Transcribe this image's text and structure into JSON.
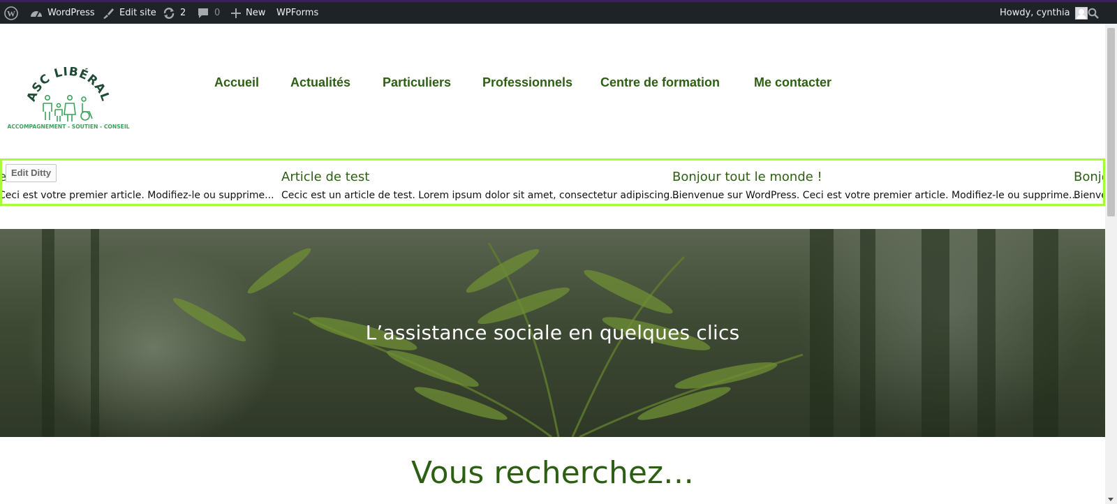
{
  "adminbar": {
    "site_name": "WordPress",
    "edit_site": "Edit site",
    "updates_count": "2",
    "comments_count": "0",
    "new_label": "New",
    "wpforms_label": "WPForms",
    "howdy": "Howdy, cynthia",
    "colors": {
      "bg": "#1d2327",
      "text": "#f0f0f1"
    }
  },
  "logo": {
    "brand_text": "ASC LIBÉRAL",
    "tagline": "ACCOMPAGNEMENT - SOUTIEN - CONSEIL"
  },
  "nav": {
    "items": [
      {
        "label": "Accueil"
      },
      {
        "label": "Actualités"
      },
      {
        "label": "Particuliers"
      },
      {
        "label": "Professionnels"
      },
      {
        "label": "Centre de formation"
      },
      {
        "label": "Me contacter"
      }
    ]
  },
  "ditty": {
    "edit_label": "Edit Ditty",
    "border_color": "#a3ff37",
    "items": [
      {
        "title": "e !",
        "excerpt": "Ceci est votre premier article. Modifiez-le ou supprime..."
      },
      {
        "title": "Article de test",
        "excerpt": "Cecic est un article de test. Lorem ipsum dolor sit amet, consectetur adipiscing..."
      },
      {
        "title": "Bonjour tout le monde !",
        "excerpt": "Bienvenue sur WordPress. Ceci est votre premier article. Modifiez-le ou supprime..."
      },
      {
        "title": "Bonjo",
        "excerpt": "Bienve"
      }
    ]
  },
  "hero": {
    "title": "L’assistance sociale en quelques clics"
  },
  "section": {
    "title": "Vous recherchez…"
  },
  "colors": {
    "brand_green": "#2c5f12",
    "logo_green": "#3aa15a"
  }
}
